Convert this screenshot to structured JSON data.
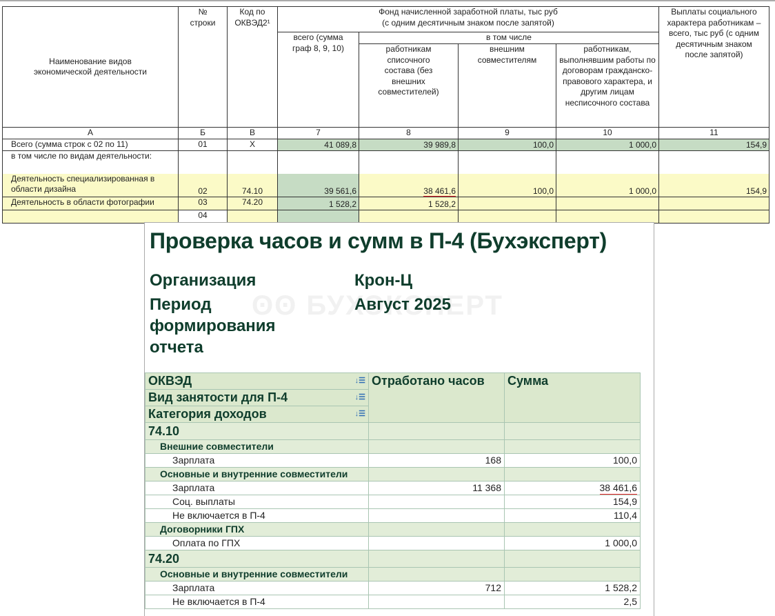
{
  "form": {
    "headers": {
      "name": "Наименование видов экономической деятельности",
      "row_no": "№ строки",
      "okved": "Код по ОКВЭД2¹",
      "fund": "Фонд начисленной заработной платы, тыс руб (с одним десятичным знаком после запятой)",
      "total": "всего (сумма граф 8, 9, 10)",
      "including": "в том числе",
      "staff": "работникам списочного состава (без внешних совместителей)",
      "external": "внешним совместителям",
      "gph": "работникам, выполнявшим работы по договорам гражданско-правового характера, и другим лицам несписочного состава",
      "social": "Выплаты социального характера работникам – всего, тыс руб (с одним десятичным знаком после запятой)"
    },
    "col_letters": [
      "А",
      "Б",
      "В",
      "7",
      "8",
      "9",
      "10",
      "11"
    ],
    "rows": [
      {
        "name": "Всего (сумма строк с 02 по 11)",
        "no": "01",
        "okved": "Х",
        "c7": "41 089,8",
        "c8": "39 989,8",
        "c9": "100,0",
        "c10": "1 000,0",
        "c11": "154,9"
      },
      {
        "pre": "в том числе по видам деятельности:",
        "name": "Деятельность специализированная в области дизайна",
        "no": "02",
        "okved": "74.10",
        "c7": "39 561,6",
        "c8": "38 461,6",
        "c9": "100,0",
        "c10": "1 000,0",
        "c11": "154,9"
      },
      {
        "name": "Деятельность в области фотографии",
        "no": "03",
        "okved": "74.20",
        "c7": "1 528,2",
        "c8": "1 528,2",
        "c9": "",
        "c10": "",
        "c11": ""
      },
      {
        "name": "",
        "no": "04",
        "okved": "",
        "c7": "",
        "c8": "",
        "c9": "",
        "c10": "",
        "c11": ""
      }
    ]
  },
  "report": {
    "title": "Проверка часов и сумм в П-4 (Бухэксперт)",
    "org_label": "Организация",
    "org_value": "Крон-Ц",
    "period_label": "Период формирования отчета",
    "period_value": "Август 2025",
    "watermark": "БУХЭКСПЕРТ",
    "columns": {
      "okved": "ОКВЭД",
      "employment": "Вид занятости для П-4",
      "category": "Категория доходов",
      "hours": "Отработано часов",
      "sum": "Сумма"
    },
    "rows": [
      {
        "type": "okved",
        "label": "74.10",
        "hours": "",
        "sum": ""
      },
      {
        "type": "sub",
        "label": "Внешние совместители",
        "hours": "",
        "sum": ""
      },
      {
        "type": "item",
        "label": "Зарплата",
        "hours": "168",
        "sum": "100,0"
      },
      {
        "type": "sub",
        "label": "Основные и внутренние совместители",
        "hours": "",
        "sum": ""
      },
      {
        "type": "item",
        "label": "Зарплата",
        "hours": "11 368",
        "sum": "38 461,6"
      },
      {
        "type": "item",
        "label": "Соц. выплаты",
        "hours": "",
        "sum": "154,9"
      },
      {
        "type": "item",
        "label": "Не включается в П-4",
        "hours": "",
        "sum": "110,4"
      },
      {
        "type": "sub",
        "label": "Договорники ГПХ",
        "hours": "",
        "sum": ""
      },
      {
        "type": "item",
        "label": "Оплата по ГПХ",
        "hours": "",
        "sum": "1 000,0"
      },
      {
        "type": "okved",
        "label": "74.20",
        "hours": "",
        "sum": ""
      },
      {
        "type": "sub",
        "label": "Основные и внутренние совместители",
        "hours": "",
        "sum": ""
      },
      {
        "type": "item",
        "label": "Зарплата",
        "hours": "712",
        "sum": "1 528,2"
      },
      {
        "type": "item",
        "label": "Не включается в П-4",
        "hours": "",
        "sum": "2,5"
      }
    ]
  }
}
